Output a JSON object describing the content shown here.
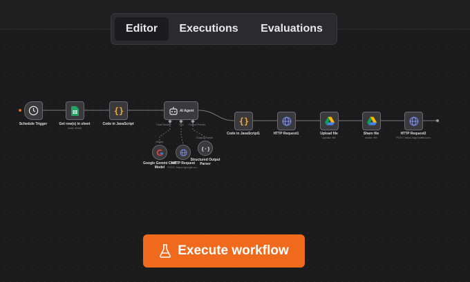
{
  "tabs": [
    {
      "label": "Editor",
      "active": true
    },
    {
      "label": "Executions",
      "active": false
    },
    {
      "label": "Evaluations",
      "active": false
    }
  ],
  "nodes": [
    {
      "name": "Schedule Trigger",
      "icon": "clock-icon"
    },
    {
      "name": "Get row(s) in sheet",
      "subtitle": "read: sheet",
      "icon": "google-sheets-icon"
    },
    {
      "name": "Code in JavaScript",
      "icon": "code-braces-icon"
    },
    {
      "name": "AI Agent",
      "icon": "robot-icon"
    },
    {
      "name": "Code in JavaScript1",
      "icon": "code-braces-icon"
    },
    {
      "name": "HTTP Request1",
      "icon": "globe-icon"
    },
    {
      "name": "Upload file",
      "subtitle": "upload: file",
      "icon": "google-drive-icon"
    },
    {
      "name": "Share file",
      "subtitle": "share: file",
      "icon": "google-drive-icon"
    },
    {
      "name": "HTTP Request2",
      "subtitle": "POST: https://api.buffer.com",
      "icon": "globe-icon"
    }
  ],
  "agent_ports": [
    {
      "label": "Chat Model*"
    },
    {
      "label": "Tool"
    },
    {
      "label": "Output Parser"
    }
  ],
  "sub_nodes": [
    {
      "port": "Model",
      "name": "Google Gemini Chat Model",
      "icon": "google-g-icon"
    },
    {
      "name": "HTTP Request",
      "subtitle": "POST: https://google.co...",
      "icon": "globe-icon"
    },
    {
      "port": "Output Parser",
      "name": "Structured Output Parser",
      "icon": "braces-parser-icon"
    }
  ],
  "execute_button": {
    "label": "Execute workflow",
    "icon": "flask-icon"
  },
  "colors": {
    "accent": "#ef6a1c",
    "trigger_dot": "#ef6a1c",
    "canvas": "#1b1b1c"
  }
}
